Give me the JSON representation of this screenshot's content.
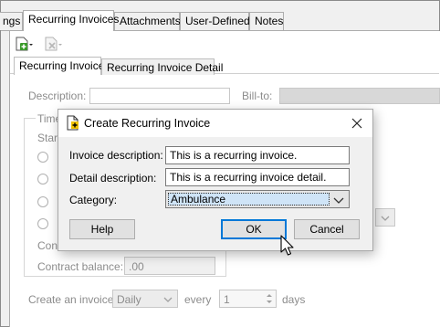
{
  "top_tabs": [
    "ngs",
    "Recurring Invoices",
    "Attachments",
    "User-Defined",
    "Notes"
  ],
  "active_top_tab": "Recurring Invoices",
  "sub_tabs": [
    "Recurring Invoice",
    "Recurring Invoice Detail"
  ],
  "form": {
    "description_label": "Description:",
    "bill_to_label": "Bill-to:",
    "time_group_label": "Time",
    "start_label": "Star",
    "contract_label": "Cont",
    "contract_balance_label": "Contract balance:",
    "contract_balance_value": ".00",
    "create_invoice_label": "Create an invoice",
    "frequency_value": "Daily",
    "every_label": "every",
    "every_value": "1",
    "days_label": "days"
  },
  "dialog": {
    "title": "Create Recurring Invoice",
    "invoice_description_label": "Invoice description:",
    "invoice_description_value": "This is a recurring invoice.",
    "detail_description_label": "Detail description:",
    "detail_description_value": "This is a recurring invoice detail.",
    "category_label": "Category:",
    "category_value": "Ambulance",
    "help_label": "Help",
    "ok_label": "OK",
    "cancel_label": "Cancel"
  },
  "colors": {
    "dialog_default_button_border": "#0078d7",
    "selected_item_background": "#cfe4f7"
  }
}
